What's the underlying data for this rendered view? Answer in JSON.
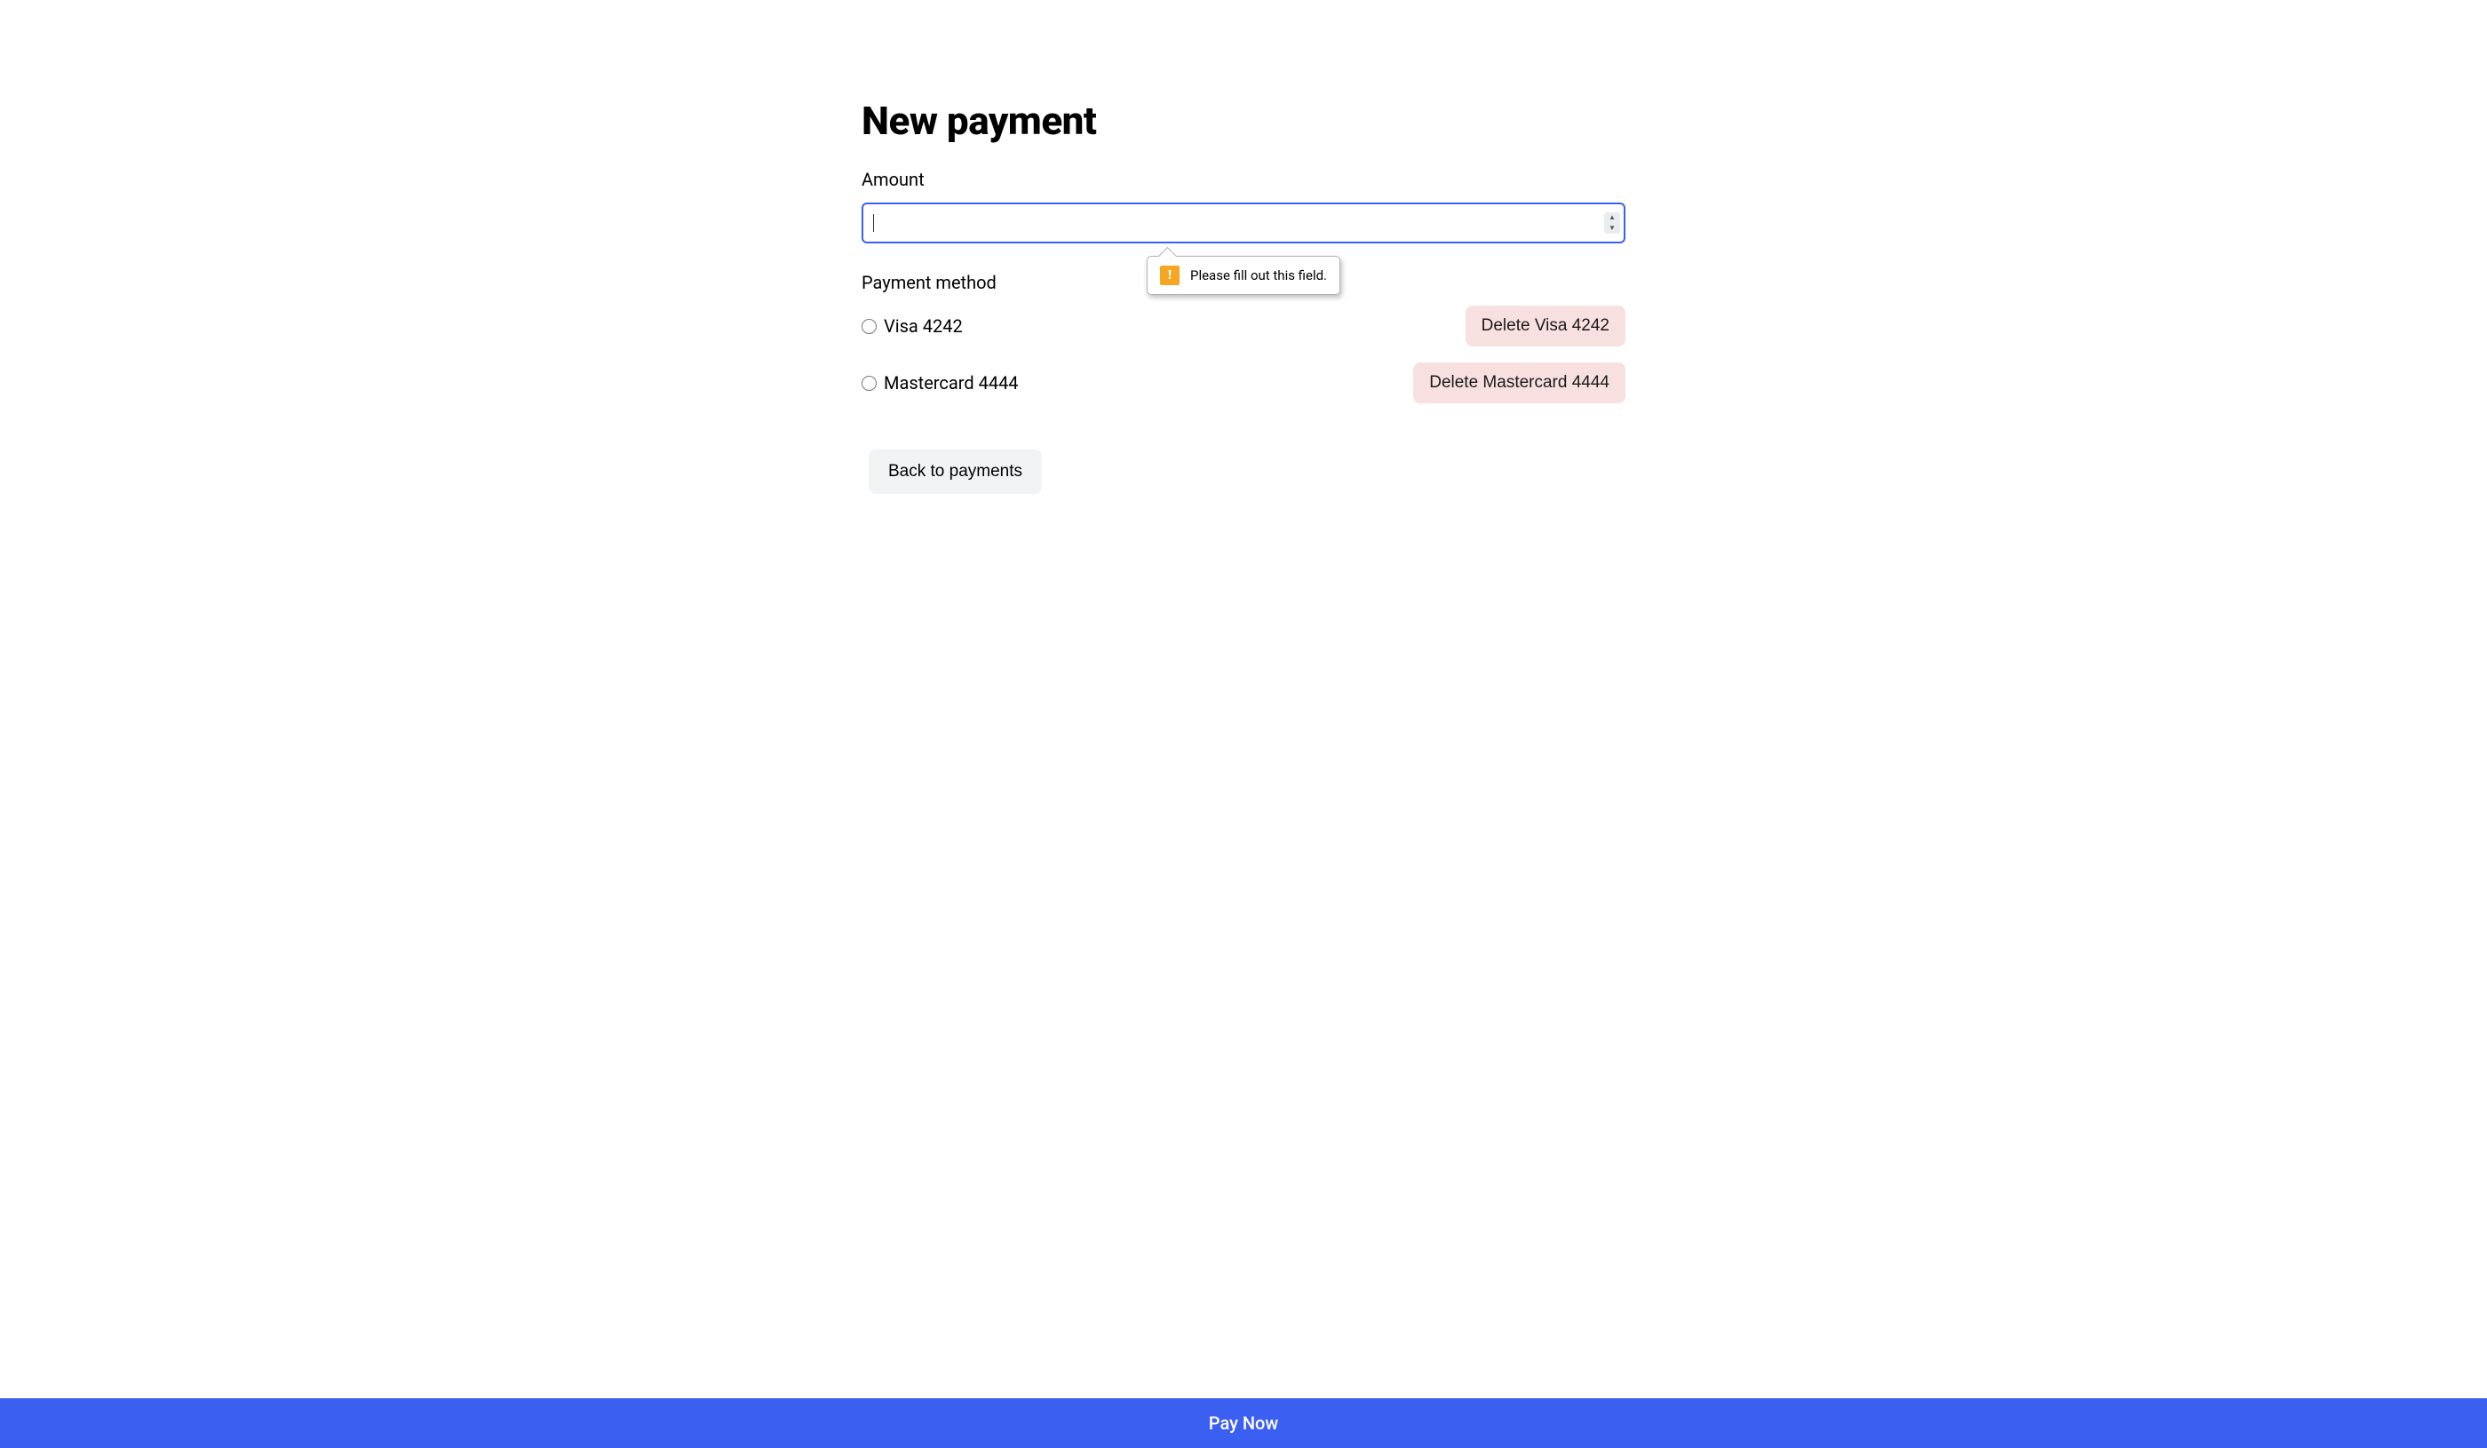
{
  "page": {
    "title": "New payment"
  },
  "form": {
    "amount": {
      "label": "Amount",
      "value": "",
      "validation_message": "Please fill out this field."
    },
    "payment_method": {
      "label": "Payment method",
      "options": [
        {
          "label": "Visa 4242",
          "delete_label": "Delete Visa 4242"
        },
        {
          "label": "Mastercard 4444",
          "delete_label": "Delete Mastercard 4444"
        }
      ]
    }
  },
  "actions": {
    "back_label": "Back to payments",
    "pay_now_label": "Pay Now"
  },
  "colors": {
    "primary": "#3b5ff0",
    "delete_bg": "#f9e0e0",
    "secondary_bg": "#f1f3f5",
    "warning_icon": "#f5a623"
  }
}
